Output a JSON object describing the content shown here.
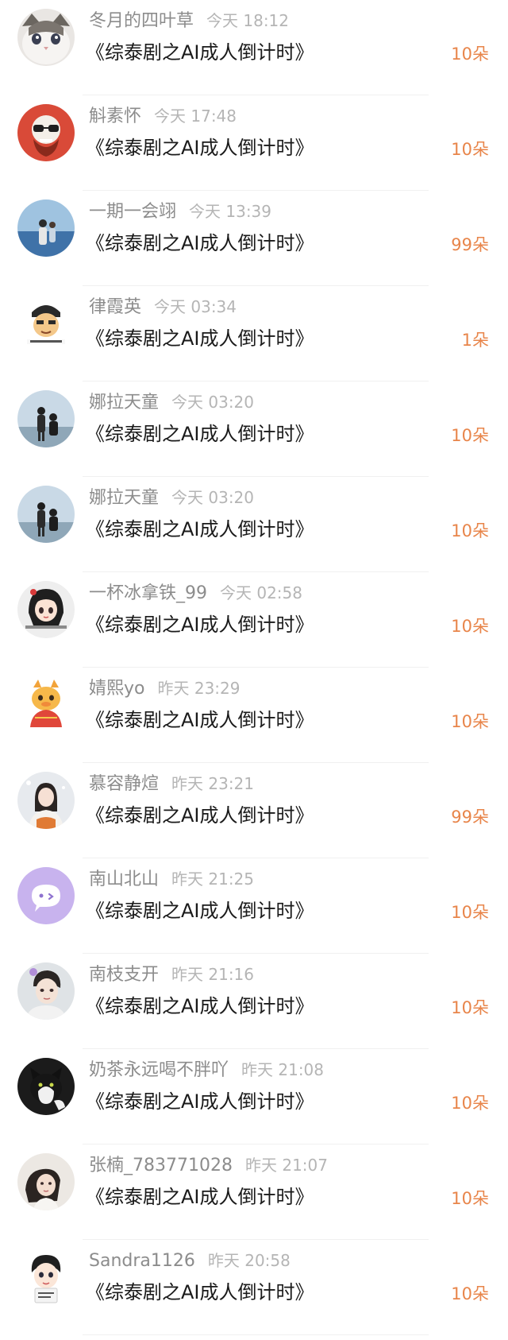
{
  "list": {
    "items": [
      {
        "name": "冬月的四叶草",
        "time": "今天 18:12",
        "title": "《综泰剧之AI成人倒计时》",
        "count": "10朵",
        "avatar": "cat-avatar-icon"
      },
      {
        "name": "斛素怀",
        "time": "今天 17:48",
        "title": "《综泰剧之AI成人倒计时》",
        "count": "10朵",
        "avatar": "skull-avatar-icon"
      },
      {
        "name": "一期一会翊",
        "time": "今天 13:39",
        "title": "《综泰剧之AI成人倒计时》",
        "count": "99朵",
        "avatar": "sea-photo-avatar-icon"
      },
      {
        "name": "律霞英",
        "time": "今天 03:34",
        "title": "《综泰剧之AI成人倒计时》",
        "count": "1朵",
        "avatar": "cartoon-man-avatar-icon"
      },
      {
        "name": "娜拉天童",
        "time": "今天 03:20",
        "title": "《综泰剧之AI成人倒计时》",
        "count": "10朵",
        "avatar": "couple-photo-avatar-icon"
      },
      {
        "name": "娜拉天童",
        "time": "今天 03:20",
        "title": "《综泰剧之AI成人倒计时》",
        "count": "10朵",
        "avatar": "couple-photo-avatar-icon"
      },
      {
        "name": "一杯冰拿铁_99",
        "time": "今天 02:58",
        "title": "《综泰剧之AI成人倒计时》",
        "count": "10朵",
        "avatar": "anime-girl-avatar-icon"
      },
      {
        "name": "婧熙yo",
        "time": "昨天 23:29",
        "title": "《综泰剧之AI成人倒计时》",
        "count": "10朵",
        "avatar": "dragon-cartoon-avatar-icon"
      },
      {
        "name": "慕容静煊",
        "time": "昨天 23:21",
        "title": "《综泰剧之AI成人倒计时》",
        "count": "99朵",
        "avatar": "snow-girl-avatar-icon"
      },
      {
        "name": "南山北山",
        "time": "昨天 21:25",
        "title": "《综泰剧之AI成人倒计时》",
        "count": "10朵",
        "avatar": "chat-bubble-avatar-icon"
      },
      {
        "name": "南枝支开",
        "time": "昨天 21:16",
        "title": "《综泰剧之AI成人倒计时》",
        "count": "10朵",
        "avatar": "portrait-avatar-icon"
      },
      {
        "name": "奶茶永远喝不胖吖",
        "time": "昨天 21:08",
        "title": "《综泰剧之AI成人倒计时》",
        "count": "10朵",
        "avatar": "black-cat-avatar-icon"
      },
      {
        "name": "张楠_783771028",
        "time": "昨天 21:07",
        "title": "《综泰剧之AI成人倒计时》",
        "count": "10朵",
        "avatar": "woman-photo-avatar-icon"
      },
      {
        "name": "Sandra1126",
        "time": "昨天 20:58",
        "title": "《综泰剧之AI成人倒计时》",
        "count": "10朵",
        "avatar": "cartoon-boy-avatar-icon"
      }
    ]
  },
  "colors": {
    "count_accent": "#e8854a",
    "title_text": "#1a1a1a",
    "name_text": "#8c8c8c",
    "time_text": "#b5b5b5"
  }
}
